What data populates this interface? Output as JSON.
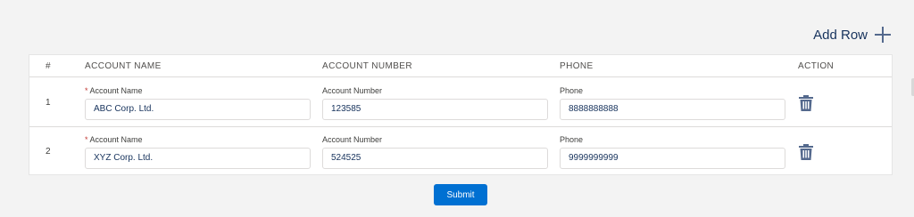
{
  "toolbar": {
    "add_row_label": "Add Row"
  },
  "table": {
    "headers": [
      "#",
      "ACCOUNT NAME",
      "ACCOUNT NUMBER",
      "PHONE",
      "ACTION"
    ],
    "field_labels": {
      "name": "Account Name",
      "number": "Account Number",
      "phone": "Phone",
      "required_marker": "*"
    },
    "rows": [
      {
        "index": "1",
        "name": "ABC Corp. Ltd.",
        "number": "123585",
        "phone": "8888888888"
      },
      {
        "index": "2",
        "name": "XYZ Corp. Ltd.",
        "number": "524525",
        "phone": "9999999999"
      }
    ]
  },
  "form": {
    "submit_label": "Submit"
  },
  "colors": {
    "brand": "#0070d2",
    "required": "#c23934",
    "text": "#16325c"
  },
  "icons": {
    "add": "plus-icon",
    "delete": "trash-icon"
  }
}
